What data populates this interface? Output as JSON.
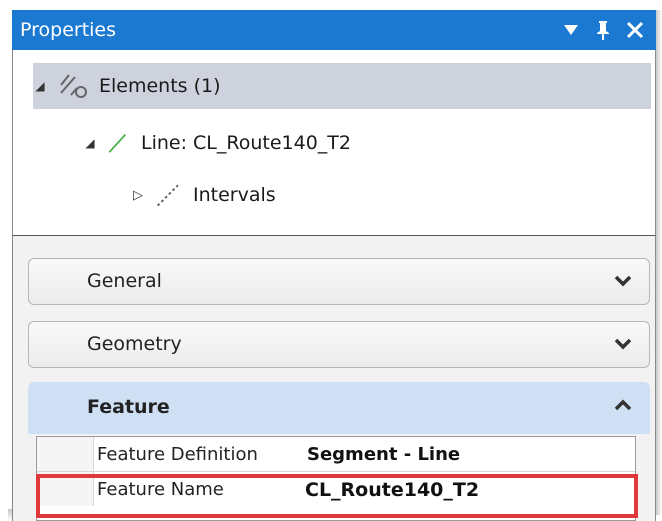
{
  "panel": {
    "title": "Properties",
    "controls": {
      "dropdown": "▼",
      "pin": "ᵽ",
      "close": "✕"
    }
  },
  "tree": {
    "root": {
      "label": "Elements (1)",
      "icon": "elements-icon",
      "expanded": true
    },
    "child": {
      "label": "Line: CL_Route140_T2",
      "icon": "line-icon",
      "color": "#3fae3f",
      "expanded": true
    },
    "grandchild": {
      "label": "Intervals",
      "icon": "dashed-line-icon",
      "expanded": false
    }
  },
  "sections": {
    "general": {
      "label": "General"
    },
    "geometry": {
      "label": "Geometry"
    },
    "feature": {
      "label": "Feature"
    }
  },
  "properties": [
    {
      "label": "Feature Definition",
      "value": "Segment - Line"
    },
    {
      "label": "Feature Name",
      "value": "CL_Route140_T2"
    }
  ],
  "colors": {
    "title_bar": "#1b79d1",
    "selection": "#cdd2dc",
    "expanded_section": "#cfe0f5",
    "highlight_box": "#e0393b"
  }
}
